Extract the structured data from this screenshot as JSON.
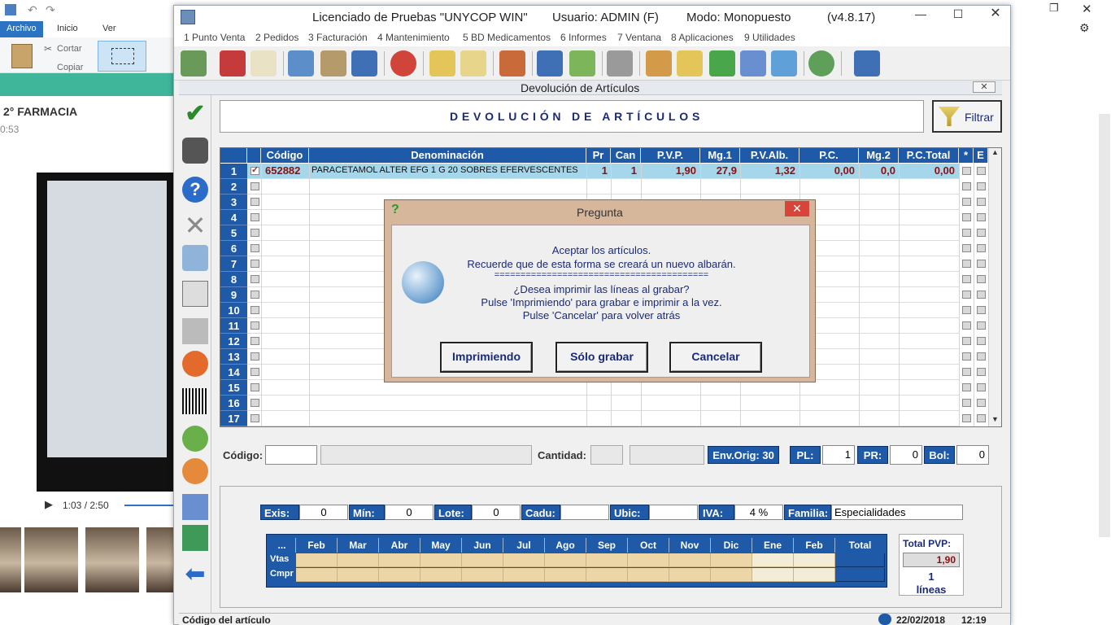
{
  "background_app": {
    "tabs": [
      "Archivo",
      "Inicio",
      "Ver"
    ],
    "ribbon": {
      "cut": "Cortar",
      "copy": "Copiar"
    },
    "chat_title": "2° FARMACIA",
    "chat_time": "0:53",
    "video_time": "1:03 / 2:50"
  },
  "window": {
    "title": "Licenciado de Pruebas \"UNYCOP WIN\"",
    "user": "Usuario: ADMIN (F)",
    "mode": "Modo: Monopuesto",
    "version": "(v4.8.17)"
  },
  "menu": [
    "1 Punto Venta",
    "2 Pedidos",
    "3 Facturación",
    "4 Mantenimiento",
    "5 BD Medicamentos",
    "6 Informes",
    "7 Ventana",
    "8 Aplicaciones",
    "9 Utilidades"
  ],
  "child_window": {
    "title": "Devolución de Artículos",
    "header": "DEVOLUCIÓN DE ARTÍCULOS",
    "filter_label": "Filtrar"
  },
  "grid": {
    "columns": [
      "Código",
      "Denominación",
      "Pr",
      "Can",
      "P.V.P.",
      "Mg.1",
      "P.V.Alb.",
      "P.C.",
      "Mg.2",
      "P.C.Total",
      "*",
      "E"
    ],
    "rows": [
      {
        "n": "1",
        "codigo": "652882",
        "denominacion": "PARACETAMOL ALTER EFG 1 G 20 SOBRES EFERVESCENTES",
        "pr": "1",
        "can": "1",
        "pvp": "1,90",
        "mg1": "27,9",
        "pvalb": "1,32",
        "pc": "0,00",
        "mg2": "0,0",
        "pctotal": "0,00"
      },
      {
        "n": "2"
      },
      {
        "n": "3"
      },
      {
        "n": "4"
      },
      {
        "n": "5"
      },
      {
        "n": "6"
      },
      {
        "n": "7"
      },
      {
        "n": "8"
      },
      {
        "n": "9"
      },
      {
        "n": "10"
      },
      {
        "n": "11"
      },
      {
        "n": "12"
      },
      {
        "n": "13"
      },
      {
        "n": "14"
      },
      {
        "n": "15"
      },
      {
        "n": "16"
      },
      {
        "n": "17"
      }
    ]
  },
  "entry": {
    "codigo_label": "Código:",
    "cantidad_label": "Cantidad:",
    "env_orig": "Env.Orig: 30",
    "pl_label": "PL:",
    "pl_value": "1",
    "pr_label": "PR:",
    "pr_value": "0",
    "bol_label": "Bol:",
    "bol_value": "0"
  },
  "stock": {
    "exis_label": "Exis:",
    "exis": "0",
    "min_label": "Mín:",
    "min": "0",
    "lote_label": "Lote:",
    "lote": "0",
    "cadu_label": "Cadu:",
    "cadu": "",
    "ubic_label": "Ubic:",
    "ubic": "",
    "iva_label": "IVA:",
    "iva": "4 %",
    "familia_label": "Familia:",
    "familia": "Especialidades"
  },
  "months": {
    "headers": [
      "...",
      "Feb",
      "Mar",
      "Abr",
      "May",
      "Jun",
      "Jul",
      "Ago",
      "Sep",
      "Oct",
      "Nov",
      "Dic",
      "Ene",
      "Feb",
      "Total"
    ],
    "rows": [
      "Vtas",
      "Cmpr"
    ]
  },
  "totals": {
    "label": "Total PVP:",
    "value": "1,90",
    "lines_count": "1",
    "lines_label": "líneas"
  },
  "status": {
    "field": "Código del artículo",
    "date": "22/02/2018",
    "time": "12:19"
  },
  "dialog": {
    "title": "Pregunta",
    "lines": [
      "Aceptar los artículos.",
      "Recuerde que de esta forma se creará un nuevo albarán.",
      "=========================================",
      "¿Desea imprimir las líneas al grabar?",
      "Pulse 'Imprimiendo' para grabar e imprimir a la vez.",
      "Pulse 'Cancelar' para volver atrás"
    ],
    "buttons": {
      "print": "Imprimiendo",
      "save": "Sólo grabar",
      "cancel": "Cancelar"
    }
  },
  "colors": {
    "grid_header": "#1e5aa8",
    "row_highlight": "#a6d6ea",
    "dialog_frame": "#d7b79c",
    "text_blue": "#1a2a7a"
  }
}
